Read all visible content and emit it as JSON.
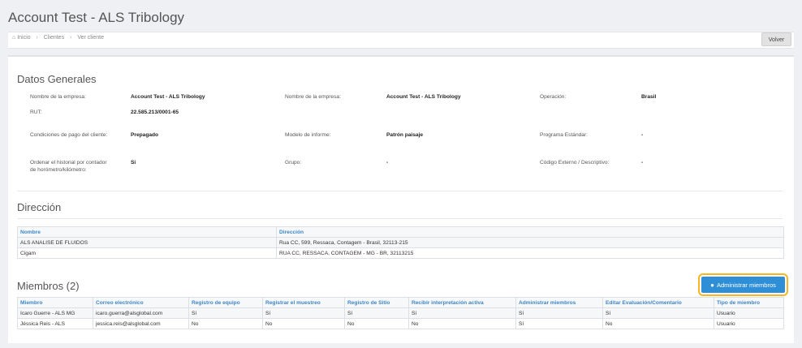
{
  "page": {
    "title": "Account Test - ALS Tribology"
  },
  "breadcrumb": {
    "home_icon": "home-icon",
    "items": [
      "Inicio",
      "Clientes",
      "Ver cliente"
    ],
    "separator": "›"
  },
  "toolbar": {
    "back_label": "Volver"
  },
  "general": {
    "heading": "Datos Generales",
    "fields": [
      {
        "label": "Nombre de la empresa:",
        "value": "Account Test - ALS Tribology"
      },
      {
        "label": "Nombre de la empresa:",
        "value": "Account Test - ALS Tribology"
      },
      {
        "label": "Operación:",
        "value": "Brasil"
      },
      {
        "label": "RUT:",
        "value": "22.585.213/0001-65"
      },
      {
        "label": "Condiciones de pago del cliente:",
        "value": "Prepagado"
      },
      {
        "label": "Modelo de informe:",
        "value": "Patrón paisaje"
      },
      {
        "label": "Programa Estándar:",
        "value": "-"
      },
      {
        "label_line1": "Ordenar el historial por contador",
        "label_line2": "de horómetro/kilómetro:",
        "value": "Sí"
      },
      {
        "label": "Grupo:",
        "value": "-"
      },
      {
        "label": "Código Externo / Descriptivo:",
        "value": "-"
      }
    ]
  },
  "address": {
    "heading": "Dirección",
    "columns": [
      "Nombre",
      "Dirección"
    ],
    "rows": [
      [
        "ALS ANALISE DE FLUIDOS",
        "Rua CC, 599, Ressaca, Contagem - Brasil, 32113-215"
      ],
      [
        "Cigam",
        "RUA CC, RESSACA, CONTAGEM - MG - BR, 32113215"
      ]
    ]
  },
  "members": {
    "heading": "Miembros (2)",
    "admin_button_label": "Administrar miembros",
    "admin_button_icon": "users-icon",
    "columns": [
      "Miembro",
      "Correo electrónico",
      "Registro de equipo",
      "Registrar el muestreo",
      "Registro de Sitio",
      "Recibir interpretación activa",
      "Administrar miembros",
      "Editar Evaluación/Comentario",
      "Tipo de miembro"
    ],
    "rows": [
      [
        "Icaro Guerre - ALS MG",
        "icaro.guerra@alsglobal.com",
        "Sí",
        "Sí",
        "Sí",
        "Sí",
        "Sí",
        "Sí",
        "Usuario"
      ],
      [
        "Jéssica Reis - ALS",
        "jessica.reis@alsglobal.com",
        "No",
        "No",
        "No",
        "No",
        "Sí",
        "No",
        "Usuario"
      ]
    ]
  }
}
